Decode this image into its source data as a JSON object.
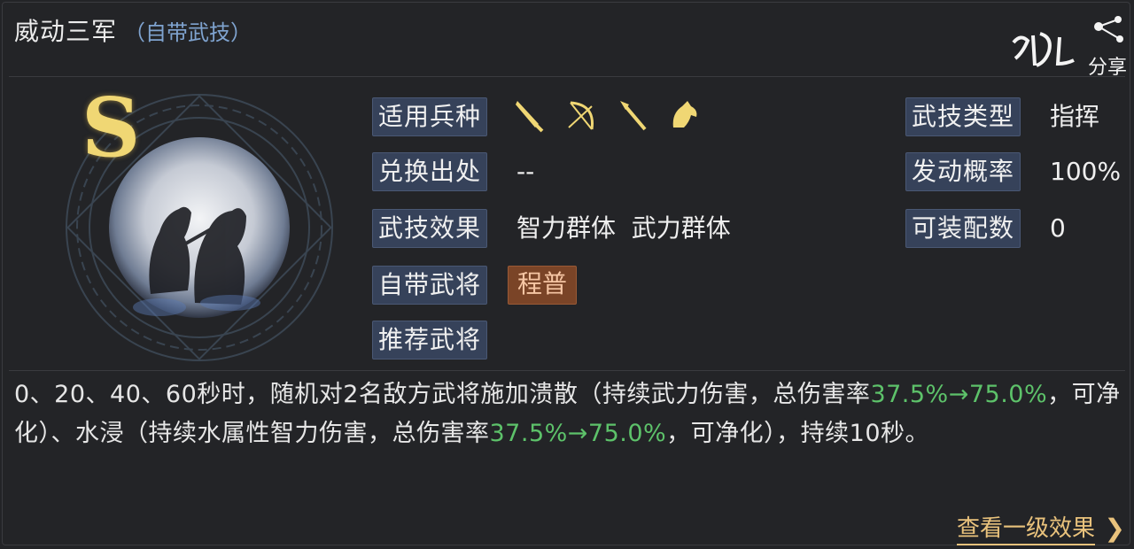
{
  "skill": {
    "name": "威动三军",
    "source_note": "（自带武技）",
    "grade": "S"
  },
  "watermark": {
    "share": "分享"
  },
  "labels": {
    "troop_types": "适用兵种",
    "exchange_source": "兑换出处",
    "effect": "武技效果",
    "own_general": "自带武将",
    "recommended_general": "推荐武将",
    "skill_type": "武技类型",
    "trigger_rate": "发动概率",
    "equip_count": "可装配数"
  },
  "values": {
    "troop_icons": [
      "sword-icon",
      "bow-icon",
      "spear-icon",
      "horse-icon"
    ],
    "exchange_source": "--",
    "effect": "智力群体  武力群体",
    "own_general": "程普",
    "skill_type": "指挥",
    "trigger_rate": "100%",
    "equip_count": "0"
  },
  "description": {
    "part1": "0、20、40、60秒时，随机对2名敌方武将施加溃散（持续武力伤害，总伤害率",
    "green1": "37.5%→75.0%",
    "part2": "，可净化）、水浸（持续水属性智力伤害，总伤害率",
    "green2": "37.5%→75.0%",
    "part3": "，可净化），持续10秒。"
  },
  "footer": {
    "link": "查看一级效果",
    "arrow": "❯"
  },
  "colors": {
    "background": "#232427",
    "tag_bg": "#36425a",
    "highlight_green": "#5dc26a",
    "link_gold": "#e9c27c",
    "grade_gold": "#f0d774",
    "general_chip": "#7a4427"
  }
}
